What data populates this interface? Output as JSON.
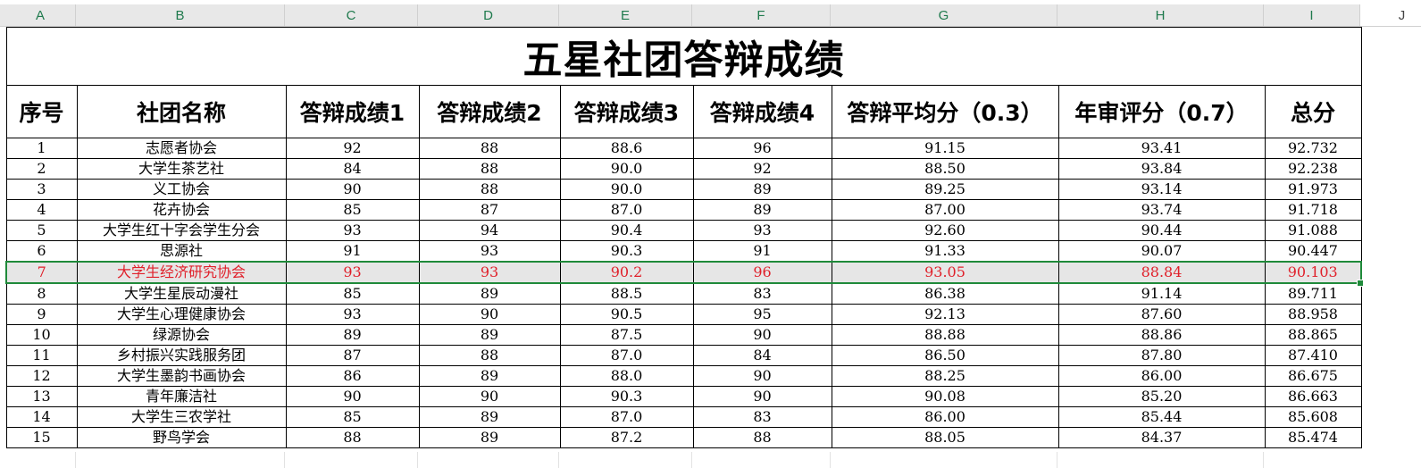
{
  "columns": [
    "A",
    "B",
    "C",
    "D",
    "E",
    "F",
    "G",
    "H",
    "I",
    "J"
  ],
  "title": "五星社团答辩成绩",
  "headers": [
    "序号",
    "社团名称",
    "答辩成绩1",
    "答辩成绩2",
    "答辩成绩3",
    "答辩成绩4",
    "答辩平均分（0.3）",
    "年审评分（0.7）",
    "总分"
  ],
  "rows": [
    [
      "1",
      "志愿者协会",
      "92",
      "88",
      "88.6",
      "96",
      "91.15",
      "93.41",
      "92.732"
    ],
    [
      "2",
      "大学生茶艺社",
      "84",
      "88",
      "90.0",
      "92",
      "88.50",
      "93.84",
      "92.238"
    ],
    [
      "3",
      "义工协会",
      "90",
      "88",
      "90.0",
      "89",
      "89.25",
      "93.14",
      "91.973"
    ],
    [
      "4",
      "花卉协会",
      "85",
      "87",
      "87.0",
      "89",
      "87.00",
      "93.74",
      "91.718"
    ],
    [
      "5",
      "大学生红十字会学生分会",
      "93",
      "94",
      "90.4",
      "93",
      "92.60",
      "90.44",
      "91.088"
    ],
    [
      "6",
      "思源社",
      "91",
      "93",
      "90.3",
      "91",
      "91.33",
      "90.07",
      "90.447"
    ],
    [
      "7",
      "大学生经济研究协会",
      "93",
      "93",
      "90.2",
      "96",
      "93.05",
      "88.84",
      "90.103"
    ],
    [
      "8",
      "大学生星辰动漫社",
      "85",
      "89",
      "88.5",
      "83",
      "86.38",
      "91.14",
      "89.711"
    ],
    [
      "9",
      "大学生心理健康协会",
      "93",
      "90",
      "90.5",
      "95",
      "92.13",
      "87.60",
      "88.958"
    ],
    [
      "10",
      "绿源协会",
      "89",
      "89",
      "87.5",
      "90",
      "88.88",
      "88.86",
      "88.865"
    ],
    [
      "11",
      "乡村振兴实践服务团",
      "87",
      "88",
      "87.0",
      "84",
      "86.50",
      "87.80",
      "87.410"
    ],
    [
      "12",
      "大学生墨韵书画协会",
      "86",
      "89",
      "88.0",
      "90",
      "88.25",
      "86.00",
      "86.675"
    ],
    [
      "13",
      "青年廉洁社",
      "90",
      "90",
      "90.3",
      "90",
      "90.08",
      "85.20",
      "86.663"
    ],
    [
      "14",
      "大学生三农学社",
      "85",
      "89",
      "87.0",
      "83",
      "86.00",
      "85.44",
      "85.608"
    ],
    [
      "15",
      "野鸟学会",
      "88",
      "89",
      "87.2",
      "88",
      "88.05",
      "84.37",
      "85.474"
    ]
  ],
  "highlight_row": 6,
  "colors": {
    "header_text": "#1f7a4d",
    "highlight_text": "#e0202a",
    "selection_border": "#1f8a3a",
    "highlight_fill": "#e6e6e6"
  }
}
